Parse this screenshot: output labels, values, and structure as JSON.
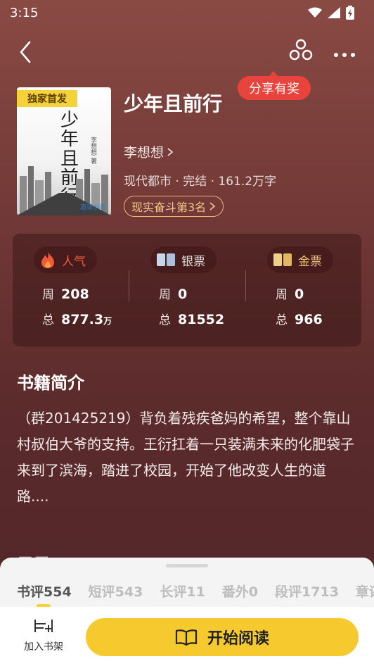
{
  "status_bar": {
    "time": "3:15"
  },
  "share_tip": "分享有奖",
  "cover": {
    "badge": "独家首发",
    "title": "少年且前行",
    "author_small": "李想想 著",
    "publisher_logo": "追读小说"
  },
  "book": {
    "title": "少年且前行",
    "author": "李想想",
    "meta": "现代都市 · 完结 · 161.2万字",
    "rank": "现实奋斗第3名"
  },
  "stats": [
    {
      "label": "人气",
      "icon": "flame-icon",
      "week_label": "周",
      "week": "208",
      "total_label": "总",
      "total": "877.3",
      "total_unit": "万"
    },
    {
      "label": "银票",
      "icon": "silver-ticket-icon",
      "week_label": "周",
      "week": "0",
      "total_label": "总",
      "total": "81552",
      "total_unit": ""
    },
    {
      "label": "金票",
      "icon": "gold-ticket-icon",
      "week_label": "周",
      "week": "0",
      "total_label": "总",
      "total": "966",
      "total_unit": ""
    }
  ],
  "intro": {
    "title": "书籍简介",
    "text": "（群201425219）背负着残疾爸妈的希望，整个靠山村叔伯大爷的支持。王衍扛着一只装满未来的化肥袋子来到了滨海，踏进了校园，开始了他改变人生的道路...."
  },
  "catalog_peek": "目录",
  "tabs": [
    "书评554",
    "短评543",
    "长评11",
    "番外0",
    "段评1713",
    "章评"
  ],
  "actions": {
    "add_shelf": "加入书架",
    "start_reading": "开始阅读"
  },
  "colors": {
    "accent_yellow": "#f6ca2e",
    "share_red": "#e8433c",
    "background": "#733a37"
  }
}
